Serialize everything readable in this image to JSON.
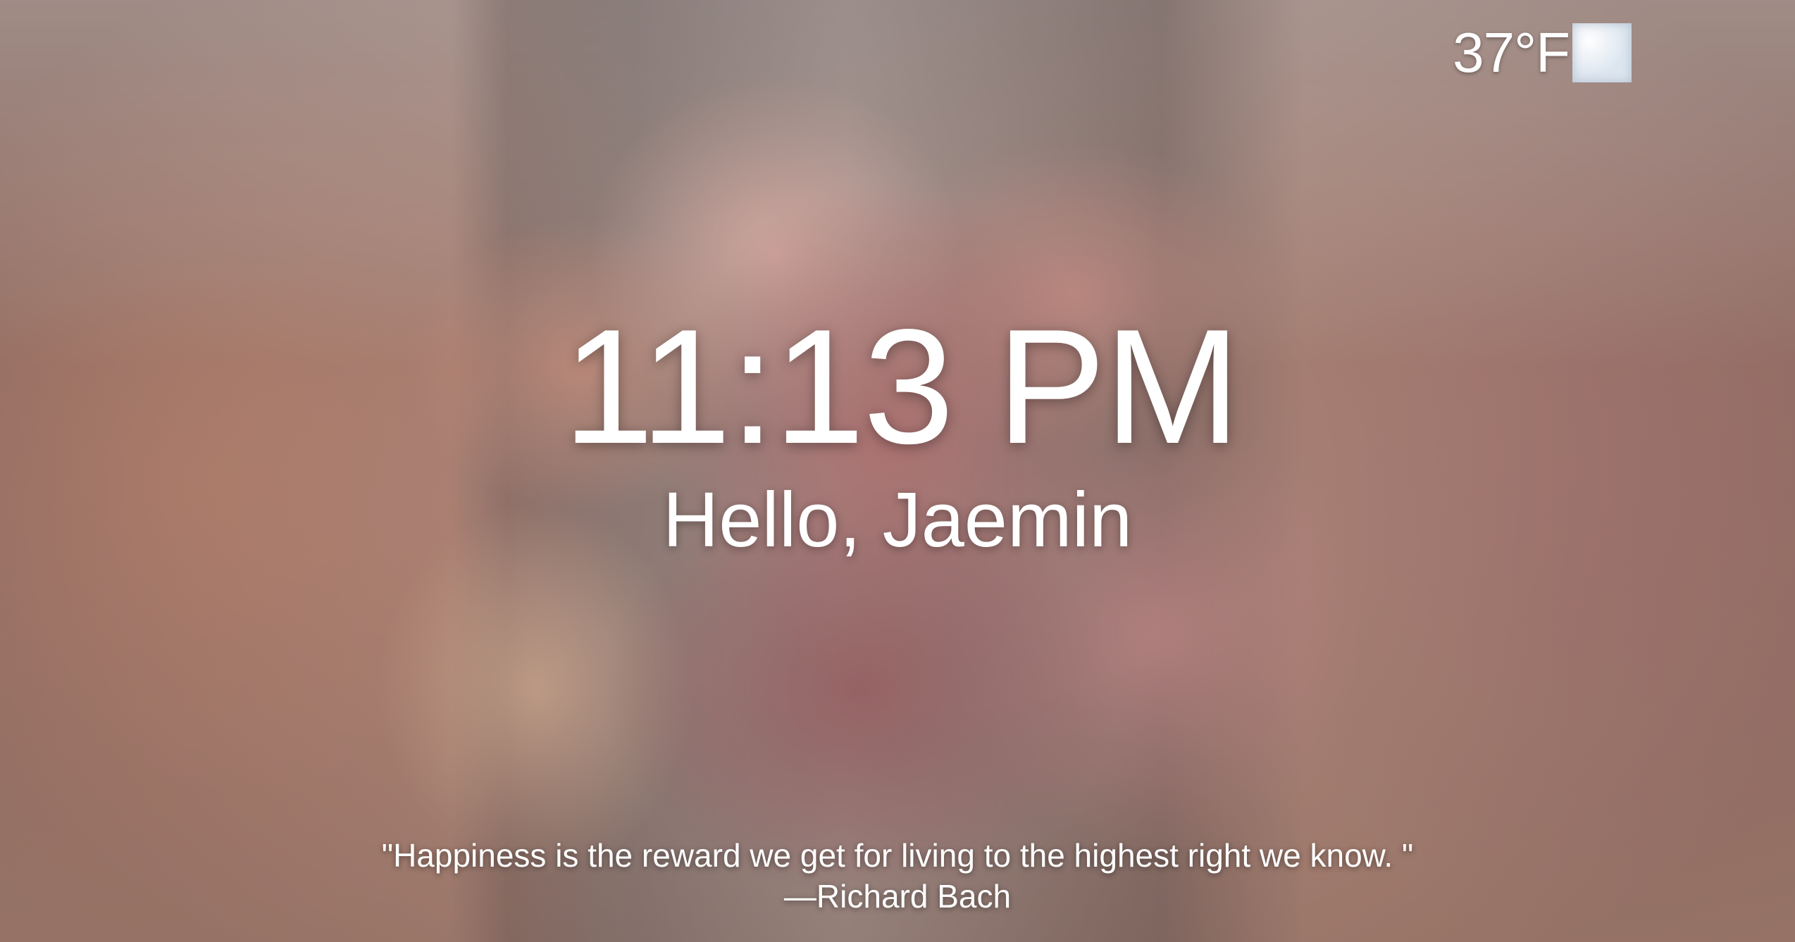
{
  "weather": {
    "temperature": "37°F",
    "icon": "cloudy-weather-icon"
  },
  "clock": {
    "time": "11:13 PM"
  },
  "greeting": {
    "text": "Hello, Jaemin"
  },
  "quote": {
    "text": "\"Happiness is the reward we get for living to the highest right we know. \"",
    "author": "—Richard Bach"
  }
}
